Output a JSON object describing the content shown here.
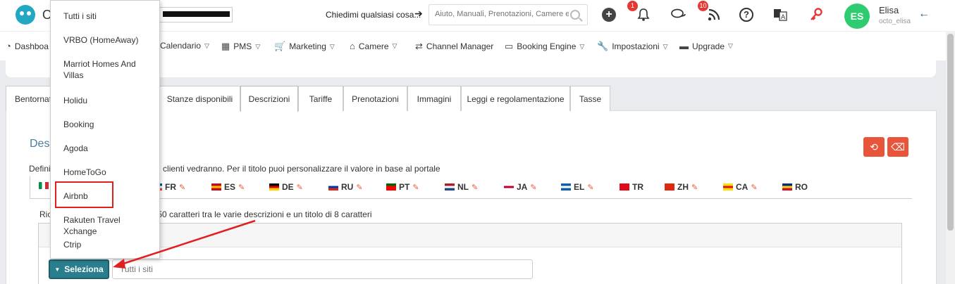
{
  "header": {
    "logo_letter": "O",
    "ask_label": "Chiedimi qualsiasi cosa...",
    "search_placeholder": "Aiuto, Manuali, Prenotazioni, Camere ecc",
    "bell_badge": "1",
    "rss_badge": "10",
    "user": {
      "initials": "ES",
      "name": "Elisa",
      "handle": "octo_elisa"
    }
  },
  "nav": {
    "items": [
      {
        "label": "Dashboa",
        "icon": "dashboard-icon"
      },
      {
        "label": "Calendario",
        "icon": "calendar-icon"
      },
      {
        "label": "PMS",
        "icon": "calendar-grid-icon"
      },
      {
        "label": "Marketing",
        "icon": "cart-icon"
      },
      {
        "label": "Camere",
        "icon": "home-icon"
      },
      {
        "label": "Channel Manager",
        "icon": "shuffle-icon"
      },
      {
        "label": "Booking Engine",
        "icon": "monitor-icon"
      },
      {
        "label": "Impostazioni",
        "icon": "wrench-icon"
      },
      {
        "label": "Upgrade",
        "icon": "card-icon"
      }
    ]
  },
  "tabs": [
    "Bentornat",
    "Stanze disponibili",
    "Descrizioni",
    "Tariffe",
    "Prenotazioni",
    "Immagini",
    "Leggi e regolamentazione",
    "Tasse"
  ],
  "active_tab": "Descrizioni",
  "section": {
    "title": "Desc",
    "description": "Defini                                          uoi clienti vedranno. Per il titolo puoi personalizzare il valore in base al portale",
    "requirement": "Ric                                      eno 50 caratteri tra le varie descrizioni e un titolo di 8 caratteri"
  },
  "languages": [
    {
      "code": "FR",
      "colors": [
        "#0055a4",
        "#ffffff",
        "#ef4135"
      ]
    },
    {
      "code": "ES",
      "colors": [
        "#c60b1e",
        "#ffc400",
        "#c60b1e"
      ]
    },
    {
      "code": "DE",
      "colors": [
        "#000000",
        "#dd0000",
        "#ffce00"
      ]
    },
    {
      "code": "RU",
      "colors": [
        "#ffffff",
        "#0039a6",
        "#d52b1e"
      ]
    },
    {
      "code": "PT",
      "colors": [
        "#006600",
        "#ff0000",
        "#ff0000"
      ]
    },
    {
      "code": "NL",
      "colors": [
        "#ae1c28",
        "#ffffff",
        "#21468b"
      ]
    },
    {
      "code": "JA",
      "colors": [
        "#ffffff",
        "#bc002d",
        "#ffffff"
      ]
    },
    {
      "code": "EL",
      "colors": [
        "#0d5eaf",
        "#ffffff",
        "#0d5eaf"
      ]
    },
    {
      "code": "TR",
      "colors": [
        "#e30a17",
        "#e30a17",
        "#e30a17"
      ]
    },
    {
      "code": "ZH",
      "colors": [
        "#de2910",
        "#de2910",
        "#de2910"
      ]
    },
    {
      "code": "CA",
      "colors": [
        "#fcdd09",
        "#da121a",
        "#fcdd09"
      ]
    },
    {
      "code": "RO",
      "colors": [
        "#002b7f",
        "#fcd116",
        "#ce1126"
      ]
    }
  ],
  "select_button": "Seleziona",
  "site_input_placeholder": "Tutti i siti",
  "dropdown": {
    "items": [
      "Tutti i siti",
      "VRBO (HomeAway)",
      "Marriot Homes And Villas",
      "Holidu",
      "Booking",
      "Agoda",
      "HomeToGo",
      "Airbnb",
      "Rakuten Travel Xchange",
      "Ctrip"
    ],
    "highlighted": "Airbnb"
  },
  "colors": {
    "accent": "#e8553b",
    "teal": "#2a7f8f",
    "avatar": "#2ecc71",
    "annotation": "#e02020"
  }
}
